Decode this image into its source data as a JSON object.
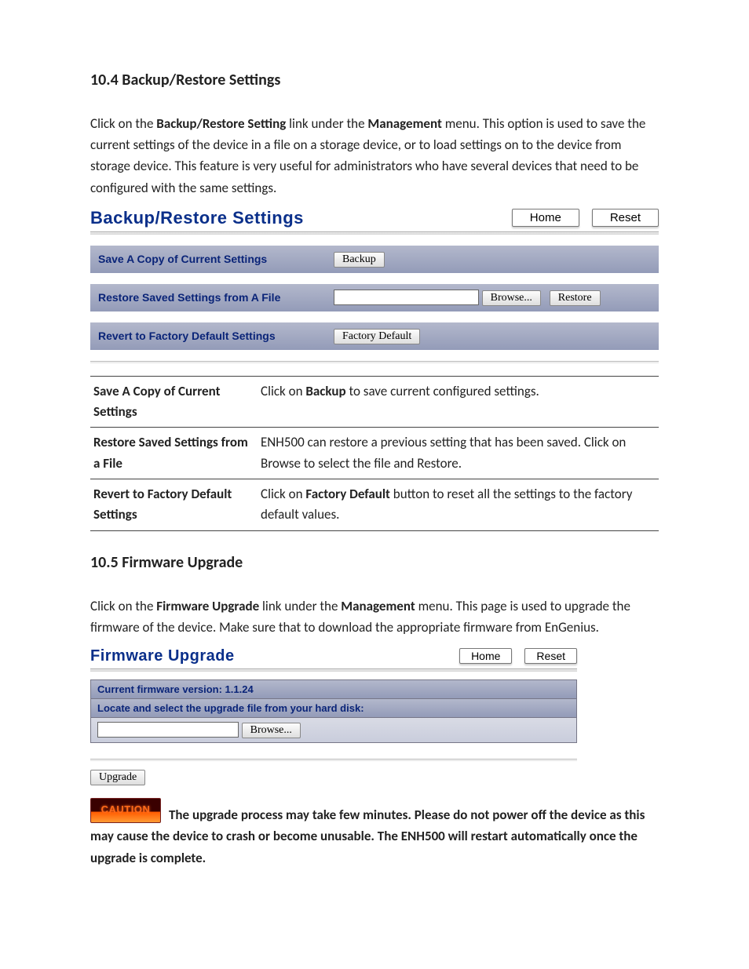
{
  "section_104": {
    "heading": "10.4 Backup/Restore Settings",
    "intro_pre": "Click on the ",
    "intro_b1": "Backup/Restore Setting",
    "intro_mid1": " link under the ",
    "intro_b2": "Management",
    "intro_post": " menu. This option is used to save the current settings of the device in a file on a storage device, or to load settings on to the device from storage device. This feature is very useful for administrators who have several devices that need to be configured with the same settings."
  },
  "ui1": {
    "title": "Backup/Restore Settings",
    "home": "Home",
    "reset": "Reset",
    "row1_label": "Save A Copy of Current Settings",
    "backup_btn": "Backup",
    "row2_label": "Restore Saved Settings from A File",
    "browse_btn": "Browse...",
    "restore_btn": "Restore",
    "row3_label": "Revert to Factory Default Settings",
    "factory_btn": "Factory Default"
  },
  "defs": {
    "r1_term": "Save A Copy of Current Settings",
    "r1_pre": "Click on ",
    "r1_b": "Backup",
    "r1_post": " to save current configured settings.",
    "r2_term": "Restore Saved Settings from a File",
    "r2_desc": "ENH500 can restore a previous setting that has been saved. Click on Browse to select the file and Restore.",
    "r3_term": "Revert to Factory Default Settings",
    "r3_pre": "Click on ",
    "r3_b": "Factory Default",
    "r3_post": " button to reset all the settings to the factory default values."
  },
  "section_105": {
    "heading": "10.5 Firmware Upgrade",
    "intro_pre": "Click on the ",
    "intro_b1": "Firmware Upgrade",
    "intro_mid1": " link under the ",
    "intro_b2": "Management",
    "intro_post": " menu. This page is used to upgrade the firmware of the device. Make sure that to download the appropriate firmware from EnGenius."
  },
  "ui2": {
    "title": "Firmware Upgrade",
    "home": "Home",
    "reset": "Reset",
    "version_label": "Current firmware version: 1.1.24",
    "locate_label": "Locate and select the upgrade file from your hard disk:",
    "browse_btn": "Browse...",
    "upgrade_btn": "Upgrade"
  },
  "caution": {
    "badge": "CAUTION",
    "text": "The upgrade process may take few minutes. Please do not power off the device as this may cause the device to crash or become unusable. The ENH500 will restart automatically once the upgrade is complete."
  }
}
